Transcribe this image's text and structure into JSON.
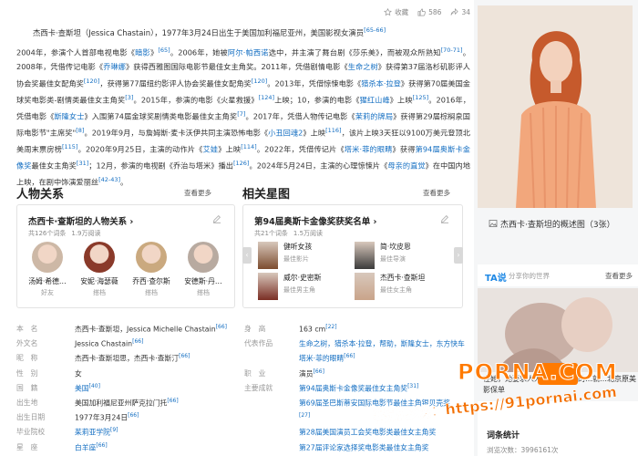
{
  "actions": {
    "collect": "收藏",
    "likes": "586",
    "shares": "34"
  },
  "lead": "杰西卡·查斯坦（Jessica Chastain），1977年3月24日出生于美国加利福尼亚州，美国影视女演员",
  "lead_ref": "[65-66]",
  "bio": [
    [
      {
        "t": "2004年，参演个人首部电视电影《"
      },
      {
        "l": "暗影"
      },
      {
        "t": "》"
      },
      {
        "r": "[65]"
      },
      {
        "t": "。2006年，她被"
      },
      {
        "l": "阿尔·帕西诺"
      },
      {
        "t": "选中，并主演了舞台剧《莎乐美》，而被观众所"
      }
    ],
    [
      {
        "t": "熟知"
      },
      {
        "r": "[70-71]"
      },
      {
        "t": "。2008年，凭借传记电影《"
      },
      {
        "l": "乔琳娜"
      },
      {
        "t": "》获得西雅图国际电影节最佳女主角奖。2011年，凭借剧情电影《"
      },
      {
        "l": "生命之树"
      },
      {
        "t": "》获"
      }
    ],
    [
      {
        "t": "得第37届洛杉矶影评人协会奖最佳女配角奖"
      },
      {
        "r": "[120]"
      },
      {
        "t": "，获得第77届纽约影评人协会奖最佳女配角奖"
      },
      {
        "r": "[120]"
      },
      {
        "t": "。2013年，凭借惊悚电影《"
      },
      {
        "l": "猎杀"
      }
    ],
    [
      {
        "l": "本·拉登"
      },
      {
        "t": "》获得第70届美国金球奖电影类-剧情类最佳女主角奖"
      },
      {
        "r": "[3]"
      },
      {
        "t": "。2015年，参演的电影《火星救援》"
      },
      {
        "r": "[124]"
      },
      {
        "t": "上映；10，参演的电"
      }
    ],
    [
      {
        "t": "影《"
      },
      {
        "l": "猩红山峰"
      },
      {
        "t": "》上映"
      },
      {
        "r": "[125]"
      },
      {
        "t": "。2016年，凭借电影《"
      },
      {
        "l": "斯隆女士"
      },
      {
        "t": "》入围第74届金球奖剧情类电影最佳女主角奖"
      },
      {
        "r": "[7]"
      },
      {
        "t": "。2017年，凭借人"
      }
    ],
    [
      {
        "t": "物传记电影《"
      },
      {
        "l": "茉莉的牌局"
      },
      {
        "t": "》获得第29届棕榈泉国际电影节\"主席奖\""
      },
      {
        "r": "[8]"
      },
      {
        "t": "。2019年9月，与詹姆斯·麦卡沃伊共同主演恐怖电影《"
      },
      {
        "l": "小"
      }
    ],
    [
      {
        "l": "丑回魂2"
      },
      {
        "t": "》上映"
      },
      {
        "r": "[116]"
      },
      {
        "t": "，该片上映3天狂以9100万美元登顶北美周末票房榜"
      },
      {
        "r": "[115]"
      },
      {
        "t": "。2020年9月25日，主演的动作片《"
      },
      {
        "l": "艾娃"
      },
      {
        "t": "》上映"
      }
    ],
    [
      {
        "r": "[114]"
      },
      {
        "t": "。2022年，凭借传记片《"
      },
      {
        "l": "塔米·菲的眼睛"
      },
      {
        "t": "》获得"
      },
      {
        "l": "第94届奥斯卡金像奖"
      },
      {
        "t": "最佳女主角奖"
      },
      {
        "r": "[31]"
      },
      {
        "t": "；12月，参演的电视剧《乔治与塔"
      }
    ],
    [
      {
        "t": "米》播出"
      },
      {
        "r": "[126]"
      },
      {
        "t": "。2024年5月24日，主演的心理惊悚片《"
      },
      {
        "l": "母亲的直觉"
      },
      {
        "t": "》在中国内地上映，在剧中饰演爱丽丝"
      },
      {
        "r": "[42-43]"
      },
      {
        "t": "。"
      }
    ]
  ],
  "relations": {
    "title": "人物关系",
    "more": "查看更多",
    "card_title": "杰西卡·查斯坦的人物关系 ›",
    "entries": "共126个词条",
    "reads": "1.9万阅读",
    "people": [
      {
        "name": "汤姆·希德…",
        "rel": "好友",
        "color": "#cdb8a6"
      },
      {
        "name": "安妮·海瑟薇",
        "rel": "搭档",
        "color": "#8a3a2a"
      },
      {
        "name": "乔西·查尔斯",
        "rel": "搭档",
        "color": "#caa97f"
      },
      {
        "name": "安德斯·丹…",
        "rel": "搭档",
        "color": "#b8aaa0"
      }
    ]
  },
  "stars": {
    "title": "相关星图",
    "more": "查看更多",
    "card_title": "第94届奥斯卡金像奖获奖名单 ›",
    "entries": "共21个词条",
    "reads": "1.5万阅读",
    "items": [
      {
        "name": "健听女孩",
        "award": "最佳影片",
        "color": "#7c4c2f"
      },
      {
        "name": "简·坎皮恩",
        "award": "最佳导演",
        "color": "#3b3b3b"
      },
      {
        "name": "威尔·史密斯",
        "award": "最佳男主角",
        "color": "#7a2e24"
      },
      {
        "name": "杰西卡·查斯坦",
        "award": "最佳女主角",
        "color": "#c9a48a"
      }
    ]
  },
  "info": {
    "left": [
      {
        "k": "本　名",
        "v": "杰西卡·查斯坦，Jessica Michelle Chastain",
        "r": "[66]"
      },
      {
        "k": "外文名",
        "v": "Jessica Chastain",
        "r": "[66]"
      },
      {
        "k": "昵　称",
        "v": "杰西卡·查斯坦思，杰西卡·查斯汀",
        "r": "[66]"
      },
      {
        "k": "性　别",
        "v": "女",
        "r": ""
      },
      {
        "k": "国　籍",
        "v": "美国",
        "r": "[40]",
        "link": true
      },
      {
        "k": "出生地",
        "v": "美国加利福尼亚州萨克拉门托",
        "r": "[66]"
      },
      {
        "k": "出生日期",
        "v": "1977年3月24日",
        "r": "[66]"
      },
      {
        "k": "毕业院校",
        "v": "茱莉亚学院",
        "r": "[9]",
        "link": true
      },
      {
        "k": "星　座",
        "v": "白羊座",
        "r": "[66]",
        "link": true
      }
    ],
    "right": [
      {
        "k": "身　高",
        "v": "163 cm",
        "r": "[22]"
      },
      {
        "k": "代表作品",
        "v": "生命之树，猎杀本·拉登，帮助，斯隆女士，东方快车",
        "r": "",
        "link": true
      },
      {
        "k": "",
        "v": "塔米·菲的眼睛",
        "r": "[66]",
        "link": true
      },
      {
        "k": "职　业",
        "v": "演员",
        "r": "[66]"
      },
      {
        "k": "主要成就",
        "v": "第94届奥斯卡金像奖最佳女主角奖",
        "r": "[31]",
        "link": true
      },
      {
        "k": "",
        "v": "第69届圣巴斯蒂安国际电影节最佳主角银贝壳奖",
        "r": "",
        "link": true
      },
      {
        "k": "",
        "v": "",
        "r": "[27]"
      },
      {
        "k": "",
        "v": "第28届美国演员工会奖电影类最佳女主角奖",
        "r": "",
        "link": true
      },
      {
        "k": "",
        "v": "第27届评论家选择奖电影类最佳女主角奖",
        "r": "",
        "link": true
      }
    ]
  },
  "side": {
    "caption": "杰西卡·查斯坦的概述图（3张）",
    "ta_logo": "TA说",
    "ta_text": "分享你的世界",
    "ta_more": "查看更多",
    "ta_caption": "在她，她要求人人平等，出镜的…就…北京原美影保单",
    "stat_title": "词条统计",
    "stat_value": "浏览次数：3996161次"
  },
  "watermark": {
    "brand": "PORNA.COM",
    "url": "番茄影视：https://91pornai.com"
  },
  "colors": {
    "link": "#136ec2",
    "accent": "#ff7a00"
  }
}
